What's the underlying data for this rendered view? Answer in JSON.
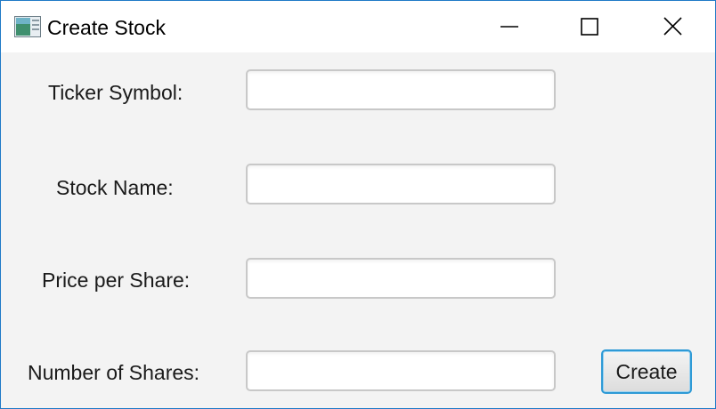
{
  "window": {
    "title": "Create Stock",
    "icon": "java-app-icon",
    "controls": [
      "minimize-icon",
      "maximize-icon",
      "close-icon"
    ]
  },
  "form": {
    "ticker_label": "Ticker Symbol:",
    "ticker_value": "",
    "name_label": "Stock Name:",
    "name_value": "",
    "price_label": "Price per Share:",
    "price_value": "",
    "shares_label": "Number of Shares:",
    "shares_value": "",
    "create_label": "Create"
  },
  "colors": {
    "window_border": "#1f7ac7",
    "content_bg": "#f3f3f3",
    "focus_ring": "#2e9ad6"
  }
}
